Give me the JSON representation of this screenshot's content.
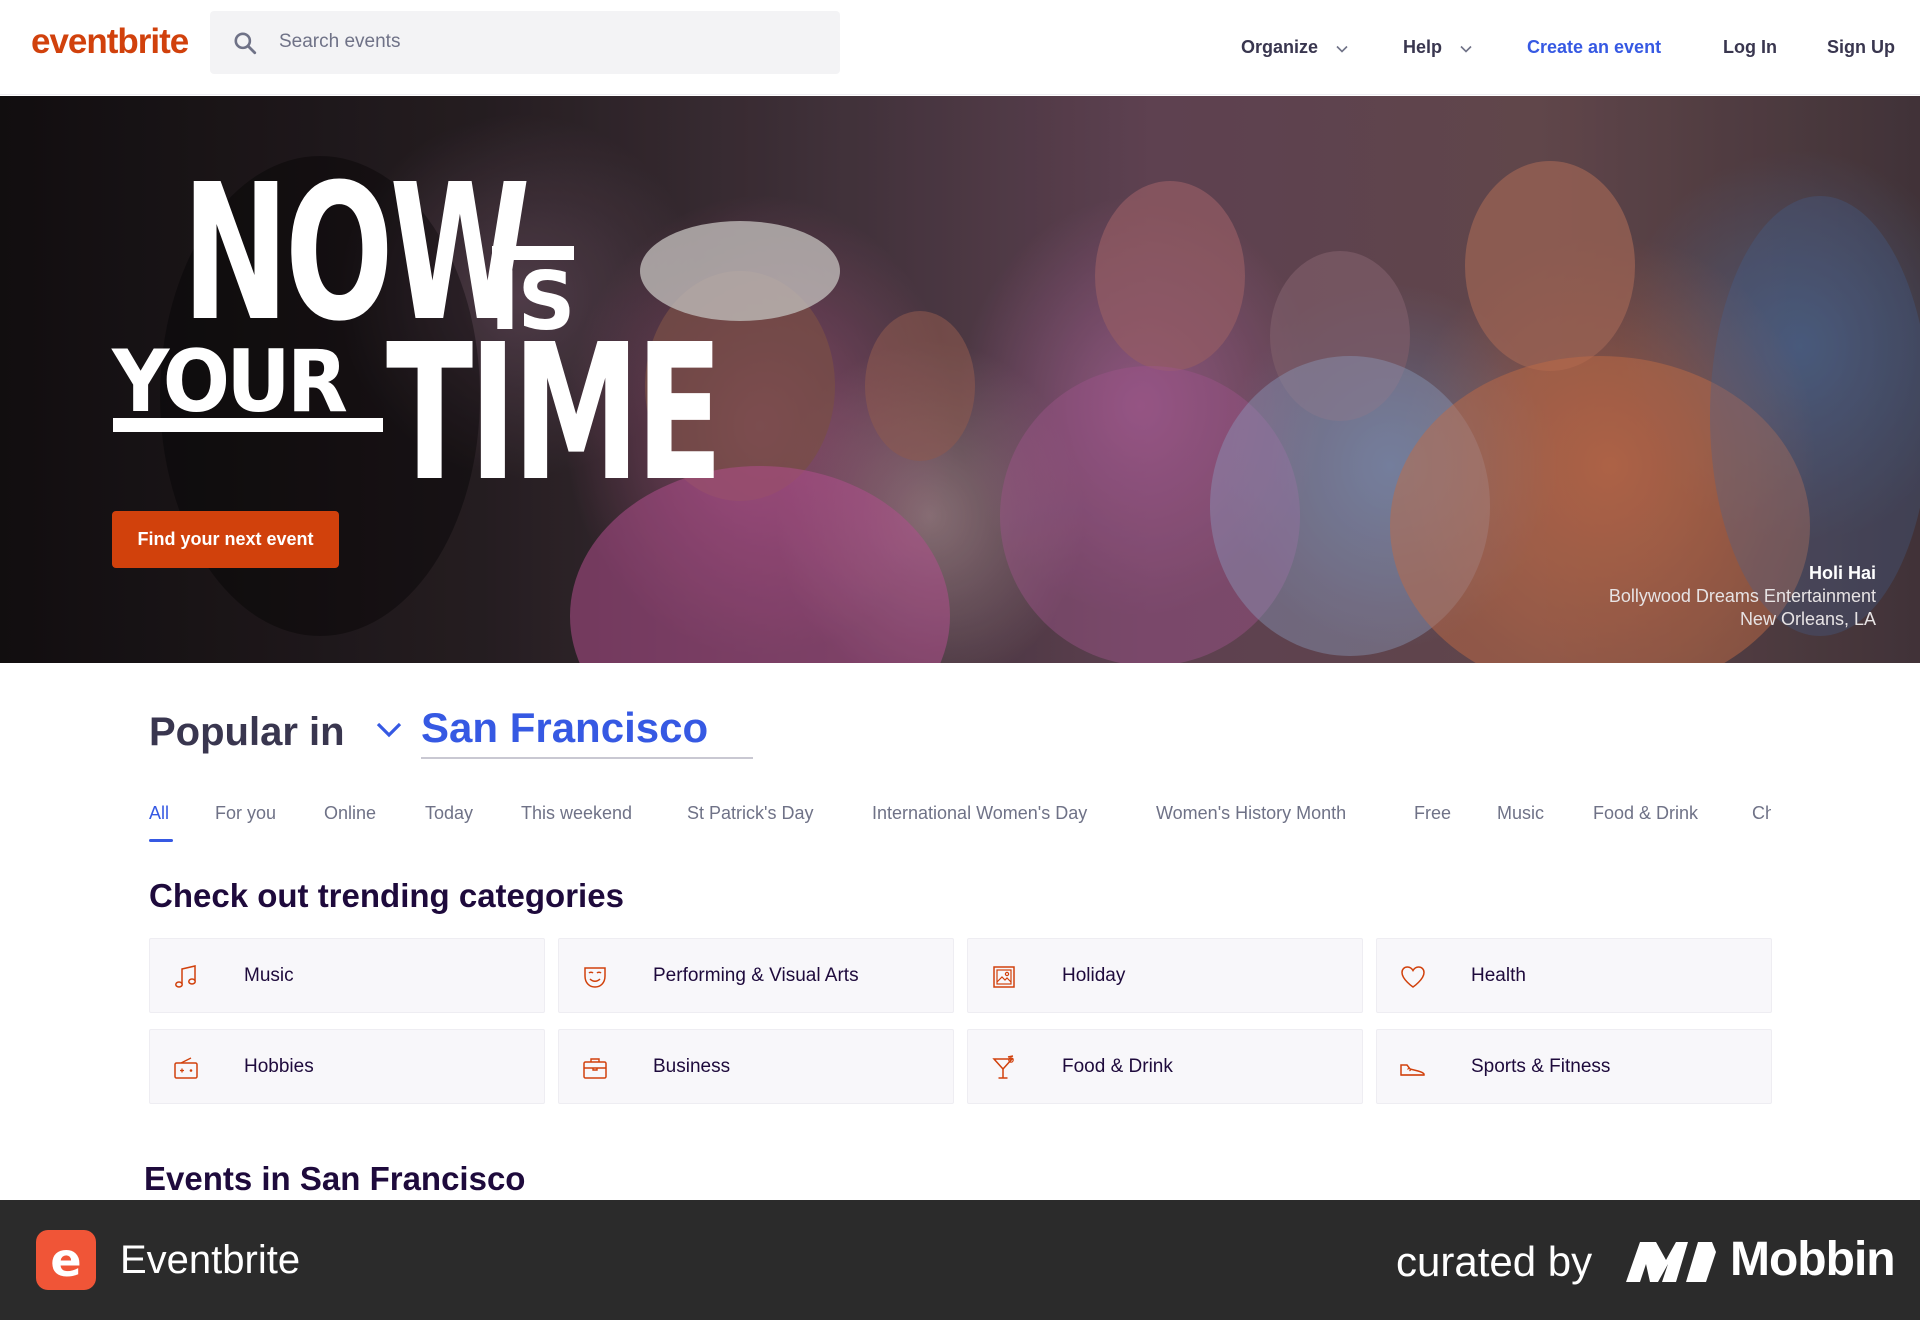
{
  "header": {
    "logo": "eventbrite",
    "search_placeholder": "Search events",
    "nav": {
      "organize": "Organize",
      "help": "Help",
      "create_event": "Create an event",
      "log_in": "Log In",
      "sign_up": "Sign Up"
    }
  },
  "hero": {
    "headline": {
      "now": "NOW",
      "is": "IS",
      "your": "YOUR",
      "time": "TIME"
    },
    "cta_label": "Find your next event",
    "credit": {
      "title": "Holi Hai",
      "organizer": "Bollywood Dreams Entertainment",
      "location": "New Orleans, LA"
    }
  },
  "popular": {
    "label": "Popular in",
    "location": "San Francisco",
    "tabs": [
      "All",
      "For you",
      "Online",
      "Today",
      "This weekend",
      "St Patrick's Day",
      "International Women's Day",
      "Women's History Month",
      "Free",
      "Music",
      "Food & Drink",
      "Ch"
    ],
    "active_tab": "All"
  },
  "trending": {
    "title": "Check out trending categories",
    "categories": [
      {
        "label": "Music",
        "icon": "music-note-icon"
      },
      {
        "label": "Performing & Visual Arts",
        "icon": "theater-mask-icon"
      },
      {
        "label": "Holiday",
        "icon": "picture-frame-icon"
      },
      {
        "label": "Health",
        "icon": "heart-icon"
      },
      {
        "label": "Hobbies",
        "icon": "radio-icon"
      },
      {
        "label": "Business",
        "icon": "briefcase-icon"
      },
      {
        "label": "Food & Drink",
        "icon": "cocktail-icon"
      },
      {
        "label": "Sports & Fitness",
        "icon": "sneaker-icon"
      }
    ]
  },
  "events": {
    "title": "Events in San Francisco"
  },
  "footer": {
    "app_icon_letter": "e",
    "app_name": "Eventbrite",
    "curated_by": "curated by",
    "brand": "Mobbin"
  },
  "colors": {
    "brand_orange": "#d1410c",
    "link_blue": "#3659e3",
    "text_dark": "#1e0a3c",
    "footer_bg": "#2b2b2b"
  }
}
